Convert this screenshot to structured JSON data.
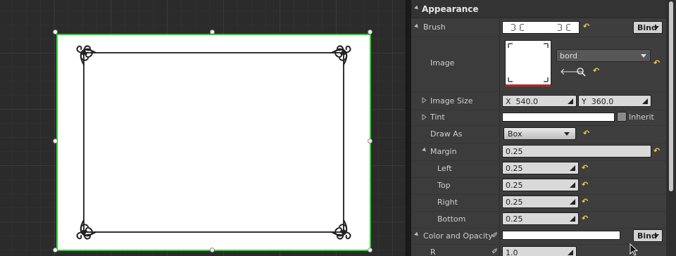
{
  "details": {
    "category": "Appearance",
    "bind_label": "Bind",
    "brush_label": "Brush",
    "image_label": "Image",
    "image_asset_name": "bord",
    "image_size_label": "Image Size",
    "image_size_x_prefix": "X",
    "image_size_x": "540.0",
    "image_size_y_prefix": "Y",
    "image_size_y": "360.0",
    "tint_label": "Tint",
    "tint_inherit_label": "Inherit",
    "draw_as_label": "Draw As",
    "draw_as_value": "Box",
    "margin_label": "Margin",
    "margin_value": "0.25",
    "left_label": "Left",
    "left_value": "0.25",
    "top_label": "Top",
    "top_value": "0.25",
    "right_label": "Right",
    "right_value": "0.25",
    "bottom_label": "Bottom",
    "bottom_value": "0.25",
    "color_opacity_label": "Color and Opacity",
    "r_label": "R",
    "r_value": "1.0"
  },
  "colors": {
    "selection": "#2ad12a",
    "reset_arrow": "#f2d23a",
    "panel_bg": "#3e3e3e",
    "viewport_bg": "#2b2b2b"
  },
  "icons": [
    "expand-arrow-icon",
    "collapse-arrow-icon",
    "reset-to-default-icon",
    "use-selected-asset-icon",
    "browse-asset-icon",
    "drag-spin-icon",
    "dropdown-caret-icon",
    "key-pin-icon",
    "mouse-cursor-icon"
  ]
}
